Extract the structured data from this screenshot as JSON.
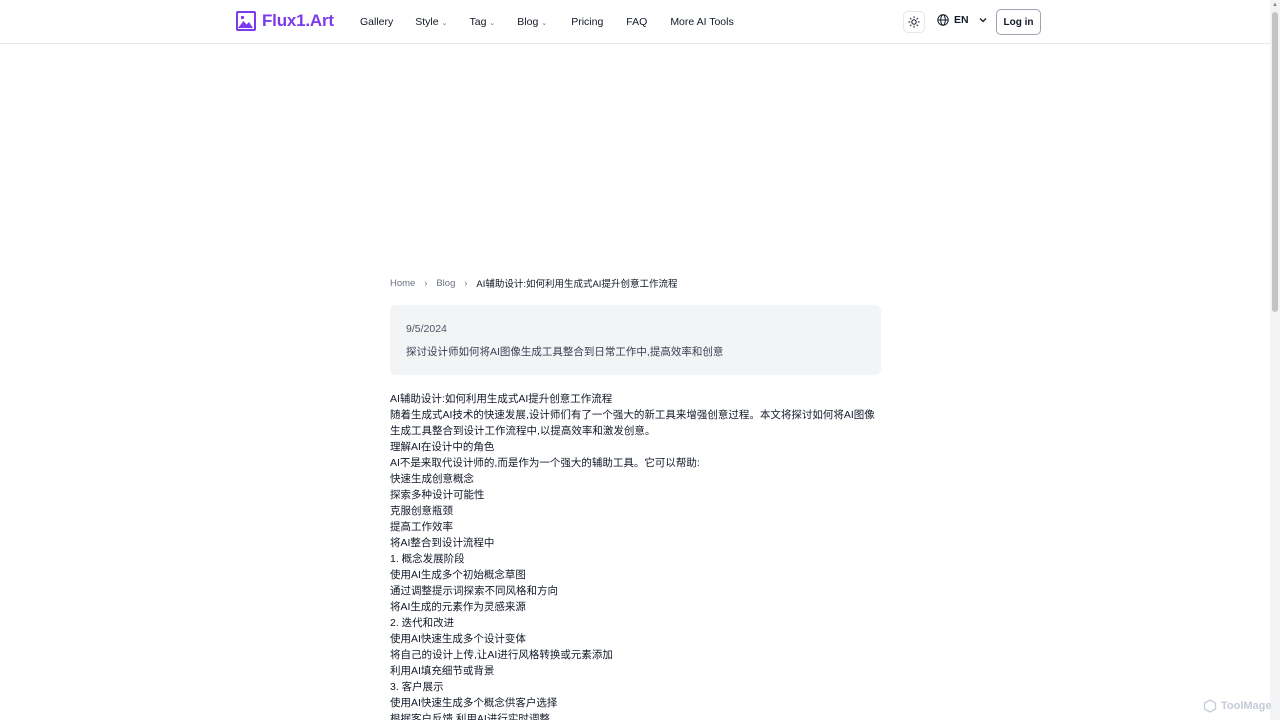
{
  "header": {
    "logo_text": "Flux1.Art",
    "nav": [
      {
        "label": "Gallery",
        "dropdown": false
      },
      {
        "label": "Style",
        "dropdown": true
      },
      {
        "label": "Tag",
        "dropdown": true
      },
      {
        "label": "Blog",
        "dropdown": true
      },
      {
        "label": "Pricing",
        "dropdown": false
      },
      {
        "label": "FAQ",
        "dropdown": false
      },
      {
        "label": "More AI Tools",
        "dropdown": false
      }
    ],
    "language": "EN",
    "login_label": "Log in"
  },
  "breadcrumb": {
    "home": "Home",
    "blog": "Blog",
    "current": "AI辅助设计:如何利用生成式AI提升创意工作流程"
  },
  "post": {
    "date": "9/5/2024",
    "summary": "探讨设计师如何将AI图像生成工具整合到日常工作中,提高效率和创意",
    "lines": [
      "AI辅助设计:如何利用生成式AI提升创意工作流程",
      "随着生成式AI技术的快速发展,设计师们有了一个强大的新工具来增强创意过程。本文将探讨如何将AI图像生成工具整合到设计工作流程中,以提高效率和激发创意。",
      "理解AI在设计中的角色",
      "AI不是来取代设计师的,而是作为一个强大的辅助工具。它可以帮助:",
      "快速生成创意概念",
      "探索多种设计可能性",
      "克服创意瓶颈",
      "提高工作效率",
      "将AI整合到设计流程中",
      "1. 概念发展阶段",
      "使用AI生成多个初始概念草图",
      "通过调整提示词探索不同风格和方向",
      "将AI生成的元素作为灵感来源",
      "2. 迭代和改进",
      "使用AI快速生成多个设计变体",
      "将自己的设计上传,让AI进行风格转换或元素添加",
      "利用AI填充细节或背景",
      "3. 客户展示",
      "使用AI快速生成多个概念供客户选择",
      "根据客户反馈,利用AI进行实时调整"
    ]
  },
  "watermark": "ToolMage",
  "colors": {
    "brand": "#7c3aed",
    "card_bg": "#f3f4f6"
  }
}
